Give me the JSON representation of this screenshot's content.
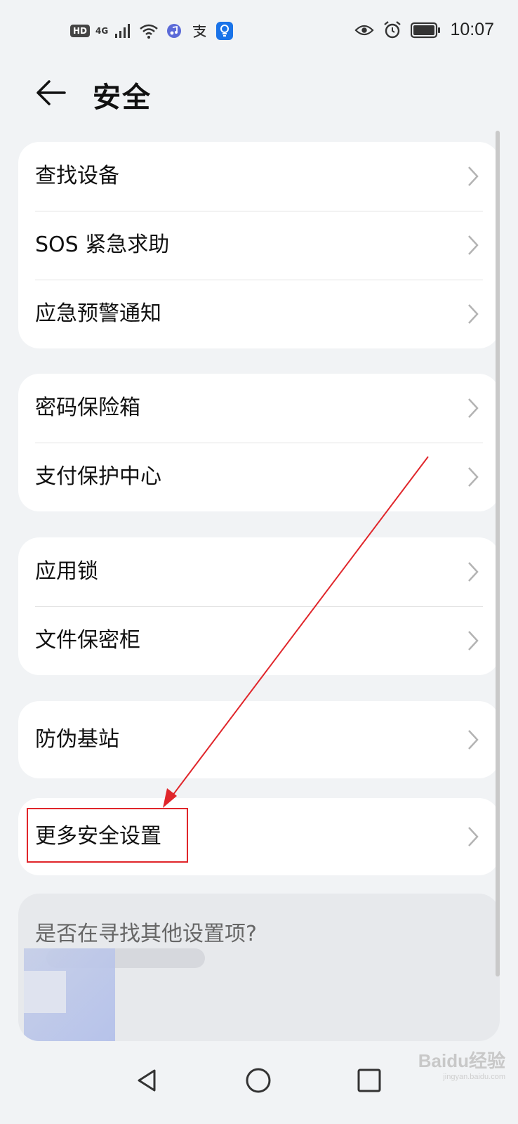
{
  "status_bar": {
    "hd": "HD",
    "network": "4G",
    "time": "10:07",
    "icons": [
      "signal-icon",
      "wifi-icon",
      "music-icon",
      "alipay-icon",
      "bulb-icon",
      "eye-icon",
      "alarm-icon",
      "battery-icon"
    ]
  },
  "header": {
    "back_icon": "back-arrow-icon",
    "title": "安全"
  },
  "groups": [
    {
      "items": [
        {
          "label": "查找设备"
        },
        {
          "label": "SOS 紧急求助"
        },
        {
          "label": "应急预警通知"
        }
      ]
    },
    {
      "items": [
        {
          "label": "密码保险箱"
        },
        {
          "label": "支付保护中心"
        }
      ]
    },
    {
      "items": [
        {
          "label": "应用锁"
        },
        {
          "label": "文件保密柜"
        }
      ]
    },
    {
      "items": [
        {
          "label": "防伪基站"
        }
      ]
    },
    {
      "items": [
        {
          "label": "更多安全设置"
        }
      ]
    }
  ],
  "hint": {
    "question": "是否在寻找其他设置项?"
  },
  "annotation": {
    "color": "#e0262b"
  },
  "nav": {
    "icons": [
      "nav-back-icon",
      "nav-home-icon",
      "nav-recents-icon"
    ]
  },
  "watermark": {
    "logo": "Baidu经验",
    "sub": "jingyan.baidu.com"
  }
}
